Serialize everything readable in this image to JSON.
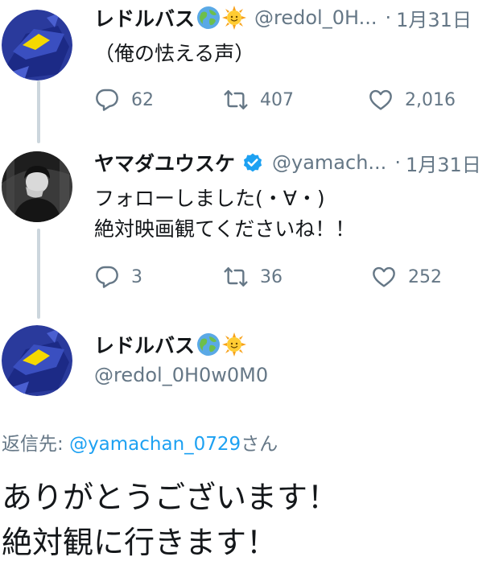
{
  "tweets": [
    {
      "name": "レドルバス",
      "handle": "@redol_0H...",
      "separator": "·",
      "date": "1月31日",
      "text_lines": [
        "（俺の怯える声）"
      ],
      "reply_count": "62",
      "retweet_count": "407",
      "like_count": "2,016"
    },
    {
      "name": "ヤマダユウスケ",
      "handle": "@yamach...",
      "separator": "·",
      "date": "1月31日",
      "text_lines": [
        "フォローしました(・∀・)",
        "絶対映画観てくださいね！！"
      ],
      "reply_count": "3",
      "retweet_count": "36",
      "like_count": "252"
    }
  ],
  "main_tweet": {
    "name": "レドルバス",
    "handle": "@redol_0H0w0M0",
    "reply_prefix": "返信先: ",
    "reply_mention": "@yamachan_0729",
    "reply_suffix": "さん",
    "text_lines": [
      "ありがとうございます！",
      "絶対観に行きます！"
    ]
  },
  "icons": [
    "earth-globe-emoji",
    "sun-emoji",
    "verified-badge-icon",
    "reply-icon",
    "retweet-icon",
    "like-icon"
  ],
  "colors": {
    "secondary_text": "#657786",
    "link": "#1da1f2",
    "thread_line": "#ccd6dd",
    "verified": "#1da1f2"
  }
}
